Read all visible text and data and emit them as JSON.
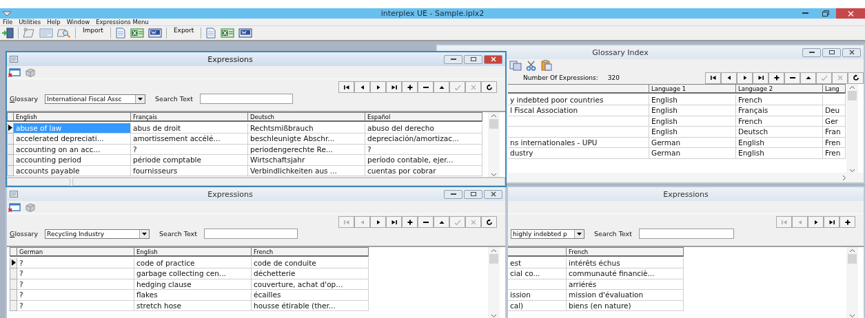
{
  "app": {
    "title": "interplex UE - Sample.iplx2"
  },
  "menu": [
    {
      "label": "File"
    },
    {
      "label": "Utilities"
    },
    {
      "label": "Help"
    },
    {
      "label": "Window"
    },
    {
      "label": "Expressions Menu"
    }
  ],
  "toolbar": {
    "import_label": "Import",
    "export_label": "Export"
  },
  "windows": [
    {
      "kind": "glossary_index",
      "title": "Glossary Index",
      "count_label": "Number Of Expressions:",
      "count": "320",
      "nav_buttons": [
        {
          "disabled": false
        },
        {
          "disabled": false
        },
        {
          "disabled": false
        },
        {
          "disabled": false
        },
        {
          "disabled": false
        },
        {
          "disabled": false
        },
        {
          "disabled": false
        },
        {
          "disabled": true
        },
        {
          "disabled": true
        },
        {
          "disabled": false
        }
      ],
      "columns": [
        {},
        {
          "label": "Language 1"
        },
        {
          "label": "Language 2"
        },
        {
          "label": "Lang"
        }
      ],
      "rows": [
        {
          "cells": [
            "y indebted poor countries",
            "English",
            "French",
            {}
          ]
        },
        {
          "cells": [
            "l Fiscal Association",
            "English",
            "Français",
            "Deu"
          ]
        },
        {
          "cells": [
            {},
            "English",
            "French",
            "Ger"
          ]
        },
        {
          "cells": [
            {},
            "English",
            "Deutsch",
            "Fran"
          ]
        },
        {
          "cells": [
            "ns internationales - UPU",
            "German",
            "English",
            "Fren"
          ]
        },
        {
          "cells": [
            "dustry",
            "German",
            "English",
            "Fren"
          ]
        }
      ]
    },
    {
      "kind": "expressions",
      "title": "Expressions",
      "active": true,
      "glossary_label": "Glossary",
      "glossary": "International Fiscal Assc",
      "search_label": "Search Text",
      "nav_buttons": [
        {
          "disabled": false
        },
        {
          "disabled": false
        },
        {
          "disabled": false
        },
        {
          "disabled": false
        },
        {
          "disabled": false
        },
        {
          "disabled": false
        },
        {
          "disabled": false
        },
        {
          "disabled": true
        },
        {
          "disabled": true
        },
        {
          "disabled": false
        }
      ],
      "columns": [
        {
          "label": "English"
        },
        {
          "label": "Français"
        },
        {
          "label": "Deutsch"
        },
        {
          "label": "Español"
        }
      ],
      "rows": [
        {
          "selected": true,
          "cells": [
            "abuse of law",
            "abus de droit",
            "Rechtsmißbrauch",
            "abuso del derecho"
          ]
        },
        {
          "selected": false,
          "cells": [
            "accelerated depreciati...",
            "amortissement accélé...",
            "beschleunigte Abschr...",
            "depreciación/amortizac..."
          ]
        },
        {
          "selected": false,
          "cells": [
            "accounting on an acc...",
            "?",
            "periodengerechte Re...",
            "?"
          ]
        },
        {
          "selected": false,
          "cells": [
            "accounting period",
            "période comptable",
            "Wirtschaftsjahr",
            "período contable, ejer..."
          ]
        },
        {
          "selected": false,
          "cells": [
            "accounts payable",
            "fournisseurs",
            "Verbindlichkeiten aus ...",
            "cuentas por cobrar"
          ]
        }
      ]
    },
    {
      "kind": "expressions",
      "title": "Expressions",
      "active": false,
      "glossary_label": "Glossary",
      "glossary": "Recycling Industry",
      "search_label": "Search Text",
      "nav_buttons": [
        {
          "disabled": true
        },
        {
          "disabled": true
        },
        {
          "disabled": false
        },
        {
          "disabled": false
        },
        {
          "disabled": false
        },
        {
          "disabled": false
        },
        {
          "disabled": false
        },
        {
          "disabled": true
        },
        {
          "disabled": true
        },
        {
          "disabled": false
        }
      ],
      "columns": [
        {
          "label": "German"
        },
        {
          "label": "English"
        },
        {
          "label": "French"
        }
      ],
      "rows": [
        {
          "selected": true,
          "cells": [
            "?",
            "code of practice",
            "code de conduite"
          ]
        },
        {
          "selected": false,
          "cells": [
            "?",
            "garbage collecting cen...",
            "déchetterie"
          ]
        },
        {
          "selected": false,
          "cells": [
            "?",
            "hedging clause",
            "couverture, achat d'op..."
          ]
        },
        {
          "selected": false,
          "cells": [
            "?",
            "flakes",
            "écailles"
          ]
        },
        {
          "selected": false,
          "cells": [
            "?",
            "stretch hose",
            "housse étirable (ther..."
          ]
        }
      ]
    },
    {
      "kind": "expressions",
      "title": "Expressions",
      "active": false,
      "glossary": "highly indebted p",
      "search_label": "Search Text",
      "nav_buttons": [
        {
          "disabled": true
        },
        {
          "disabled": true
        },
        {
          "disabled": false
        },
        {
          "disabled": false
        },
        {
          "disabled": false
        }
      ],
      "columns": [
        {},
        {
          "label": "French"
        }
      ],
      "rows": [
        {
          "cells": [
            "est",
            "intérêts échus"
          ]
        },
        {
          "cells": [
            "cial co...",
            "communauté financiè..."
          ]
        },
        {
          "cells": [
            {},
            "arriérés"
          ]
        },
        {
          "cells": [
            "ission",
            "mission d'évaluation"
          ]
        },
        {
          "cells": [
            "cal)",
            "biens (en nature)"
          ]
        }
      ]
    }
  ]
}
